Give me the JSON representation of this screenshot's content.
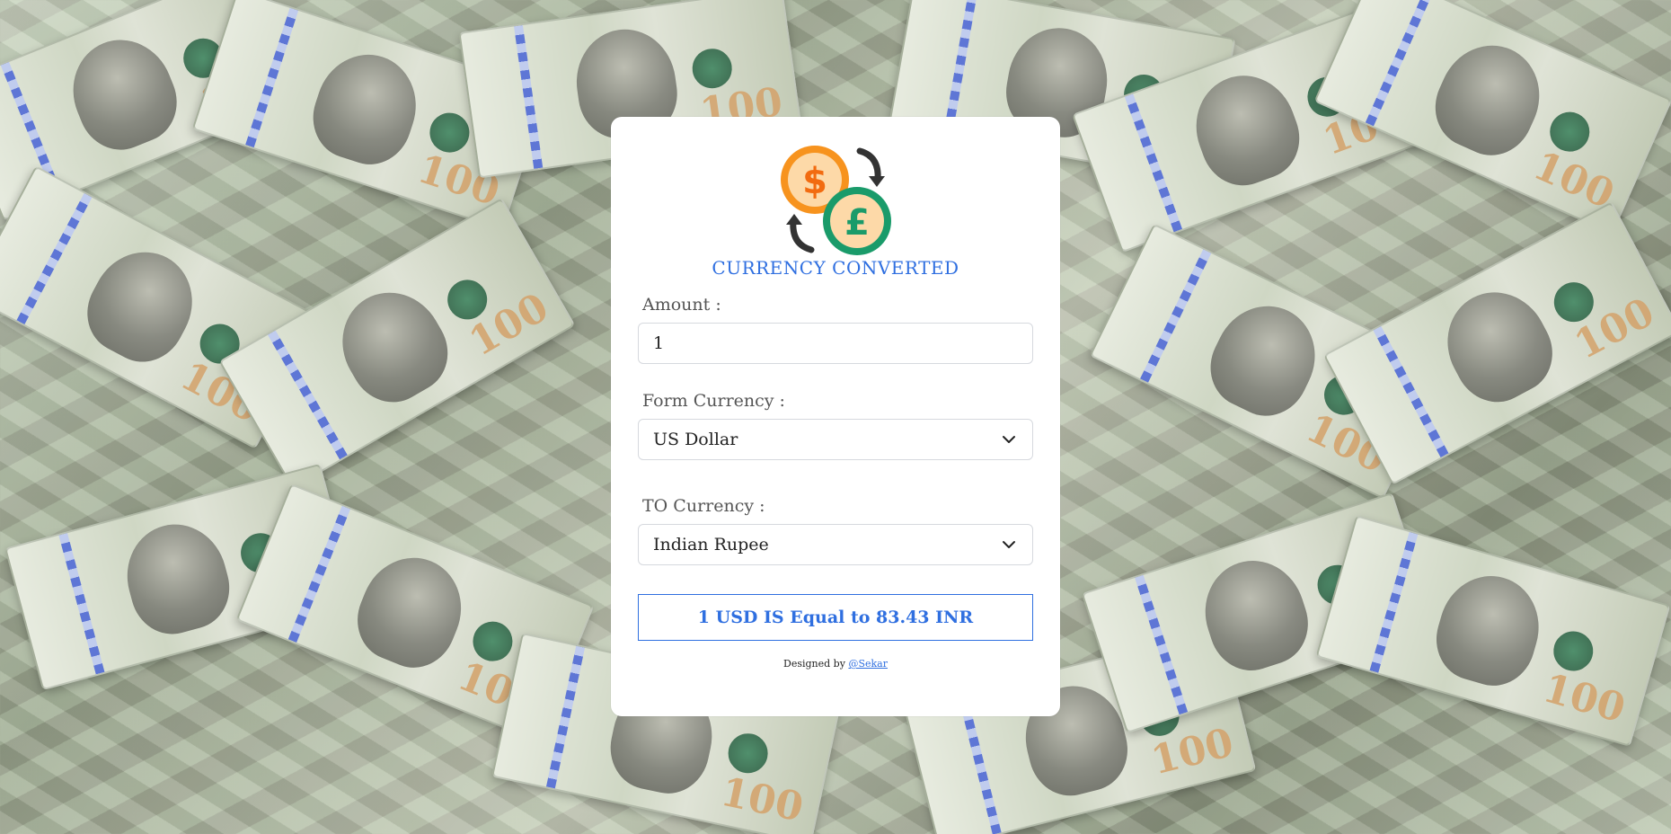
{
  "app": {
    "title": "CURRENCY CONVERTED"
  },
  "form": {
    "amount_label": "Amount :",
    "amount_value": "1",
    "from_label": "Form Currency :",
    "from_value": "US Dollar",
    "to_label": "TO Currency :",
    "to_value": "Indian Rupee"
  },
  "result": {
    "text": "1 USD IS Equal to 83.43 INR"
  },
  "footer": {
    "prefix": "Designed by",
    "link_text": "@Sekar"
  },
  "icons": {
    "logo": "currency-exchange-icon",
    "dropdown": "chevron-down-icon"
  },
  "colors": {
    "accent": "#2f6fe0",
    "card": "#ffffff",
    "dollar_coin": "#f7931e",
    "pound_coin": "#1a9b6a"
  }
}
